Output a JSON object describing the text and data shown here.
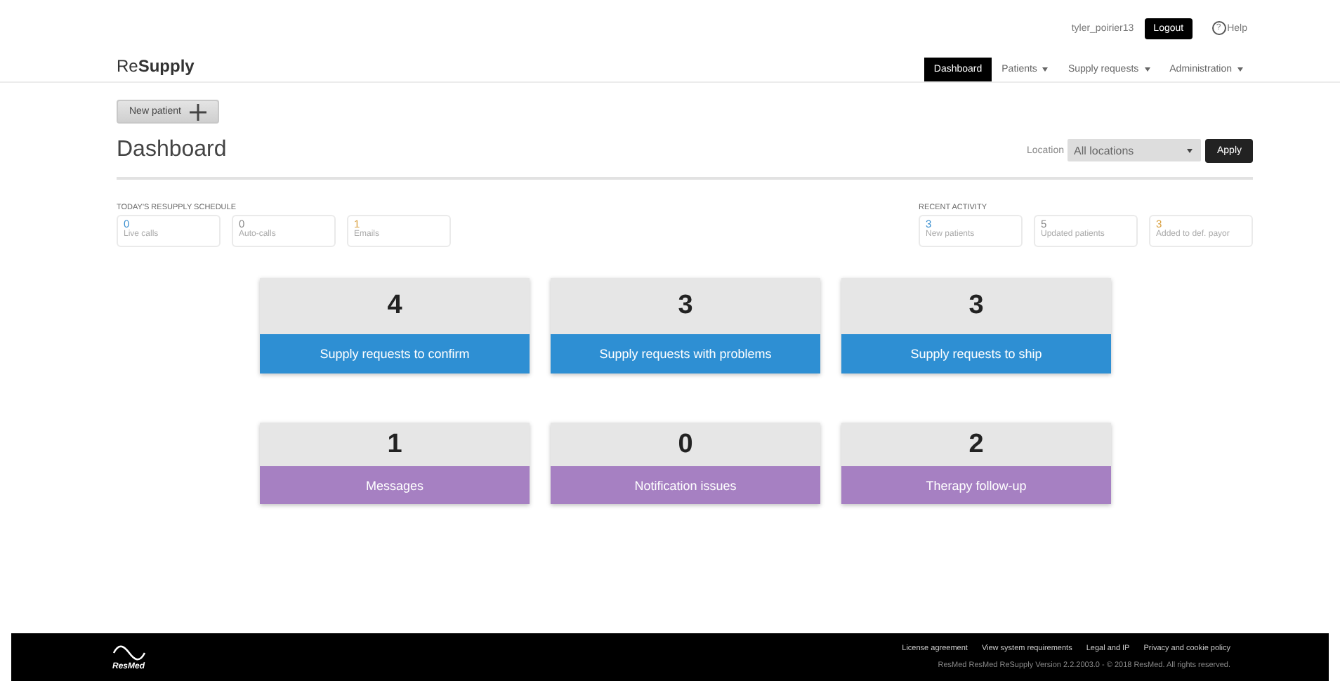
{
  "user_bar": {
    "username": "tyler_poirier13",
    "logout": "Logout",
    "help_icon": "?",
    "help": "Help"
  },
  "brand": {
    "light": "Re",
    "bold": "Supply"
  },
  "nav": [
    {
      "label": "Dashboard",
      "selected": true,
      "dropdown": false
    },
    {
      "label": "Patients",
      "selected": false,
      "dropdown": true
    },
    {
      "label": "Supply requests",
      "selected": false,
      "dropdown": true
    },
    {
      "label": "Administration",
      "selected": false,
      "dropdown": true
    }
  ],
  "new_patient_button": "New patient",
  "page_title": "Dashboard",
  "location_filter": {
    "label": "Location",
    "value": "All locations",
    "apply": "Apply"
  },
  "schedule": {
    "heading": "TODAY'S RESUPPLY SCHEDULE",
    "items": [
      {
        "count": "0",
        "label": "Live calls",
        "color": "#3a8fd0"
      },
      {
        "count": "0",
        "label": "Auto-calls",
        "color": "#888888"
      },
      {
        "count": "1",
        "label": "Emails",
        "color": "#d9a040"
      }
    ]
  },
  "recent_activity": {
    "heading": "RECENT ACTIVITY",
    "items": [
      {
        "count": "3",
        "label": "New patients",
        "color": "#3a8fd0"
      },
      {
        "count": "5",
        "label": "Updated patients",
        "color": "#888888"
      },
      {
        "count": "3",
        "label": "Added to def. payor",
        "color": "#d9a040"
      }
    ]
  },
  "tile_rows": [
    {
      "kind": "supply",
      "tiles": [
        {
          "count": "4",
          "label": "Supply requests to confirm"
        },
        {
          "count": "3",
          "label": "Supply requests with problems"
        },
        {
          "count": "3",
          "label": "Supply requests to ship"
        }
      ]
    },
    {
      "kind": "message",
      "tiles": [
        {
          "count": "1",
          "label": "Messages"
        },
        {
          "count": "0",
          "label": "Notification issues"
        },
        {
          "count": "2",
          "label": "Therapy follow-up"
        }
      ]
    }
  ],
  "footer": {
    "logo": "ResMed",
    "links": [
      "License agreement",
      "View system requirements",
      "Legal and IP",
      "Privacy and cookie policy"
    ],
    "copyright": "ResMed ResMed ReSupply Version 2.2.2003.0  -  © 2018 ResMed. All rights reserved."
  }
}
